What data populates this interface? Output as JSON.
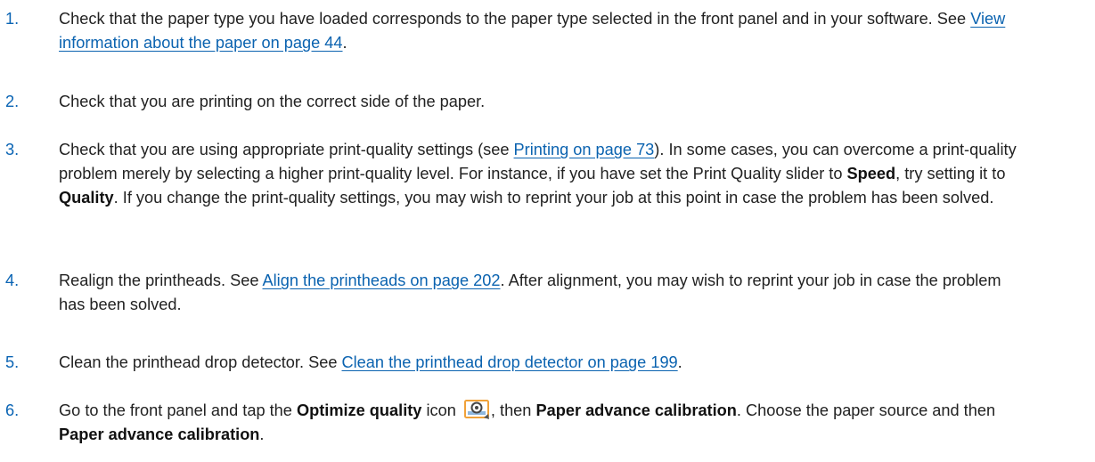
{
  "steps": [
    {
      "num": "1.",
      "t1": "Check that the paper type you have loaded corresponds to the paper type selected in the front panel and in your software. See ",
      "link1": "View information about the paper on page 44",
      "t2": "."
    },
    {
      "num": "2.",
      "t1": "Check that you are printing on the correct side of the paper."
    },
    {
      "num": "3.",
      "t1": "Check that you are using appropriate print-quality settings (see ",
      "link1": "Printing on page 73",
      "t2": "). In some cases, you can overcome a print-quality problem merely by selecting a higher print-quality level. For instance, if you have set the Print Quality slider to ",
      "b1": "Speed",
      "t3": ", try setting it to ",
      "b2": "Quality",
      "t4": ". If you change the print-quality settings, you may wish to reprint your job at this point in case the problem has been solved."
    },
    {
      "num": "4.",
      "t1": "Realign the printheads. See ",
      "link1": "Align the printheads on page 202",
      "t2": ". After alignment, you may wish to reprint your job in case the problem has been solved."
    },
    {
      "num": "5.",
      "t1": "Clean the printhead drop detector. See ",
      "link1": "Clean the printhead drop detector on page 199",
      "t2": "."
    },
    {
      "num": "6.",
      "t1": "Go to the front panel and tap the ",
      "b1": "Optimize quality",
      "t2": "  icon ",
      "icon": "optimize-quality-icon",
      "t3": ", then ",
      "b2": "Paper advance calibration",
      "t4": ". Choose the paper source and then ",
      "b3": "Paper advance calibration",
      "t5": "."
    }
  ],
  "colors": {
    "link": "#0b63b0",
    "number": "#0a64b4",
    "text": "#222222"
  }
}
